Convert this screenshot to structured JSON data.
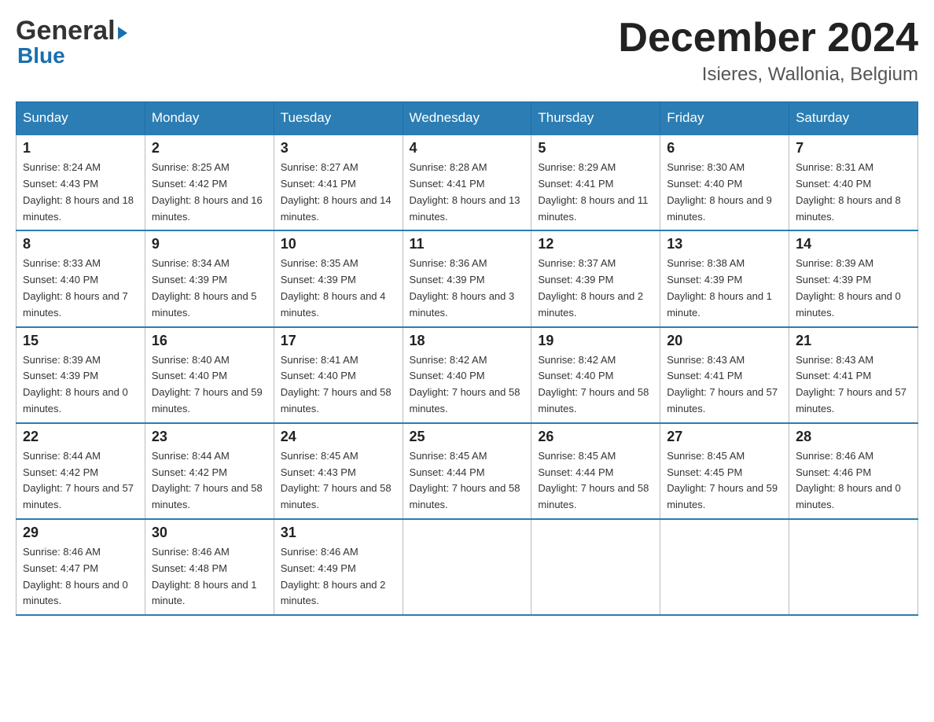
{
  "header": {
    "logo_general": "General",
    "logo_arrow": "▶",
    "logo_blue": "Blue",
    "month_title": "December 2024",
    "location": "Isieres, Wallonia, Belgium"
  },
  "weekdays": [
    "Sunday",
    "Monday",
    "Tuesday",
    "Wednesday",
    "Thursday",
    "Friday",
    "Saturday"
  ],
  "weeks": [
    [
      {
        "day": "1",
        "sunrise": "Sunrise: 8:24 AM",
        "sunset": "Sunset: 4:43 PM",
        "daylight": "Daylight: 8 hours and 18 minutes."
      },
      {
        "day": "2",
        "sunrise": "Sunrise: 8:25 AM",
        "sunset": "Sunset: 4:42 PM",
        "daylight": "Daylight: 8 hours and 16 minutes."
      },
      {
        "day": "3",
        "sunrise": "Sunrise: 8:27 AM",
        "sunset": "Sunset: 4:41 PM",
        "daylight": "Daylight: 8 hours and 14 minutes."
      },
      {
        "day": "4",
        "sunrise": "Sunrise: 8:28 AM",
        "sunset": "Sunset: 4:41 PM",
        "daylight": "Daylight: 8 hours and 13 minutes."
      },
      {
        "day": "5",
        "sunrise": "Sunrise: 8:29 AM",
        "sunset": "Sunset: 4:41 PM",
        "daylight": "Daylight: 8 hours and 11 minutes."
      },
      {
        "day": "6",
        "sunrise": "Sunrise: 8:30 AM",
        "sunset": "Sunset: 4:40 PM",
        "daylight": "Daylight: 8 hours and 9 minutes."
      },
      {
        "day": "7",
        "sunrise": "Sunrise: 8:31 AM",
        "sunset": "Sunset: 4:40 PM",
        "daylight": "Daylight: 8 hours and 8 minutes."
      }
    ],
    [
      {
        "day": "8",
        "sunrise": "Sunrise: 8:33 AM",
        "sunset": "Sunset: 4:40 PM",
        "daylight": "Daylight: 8 hours and 7 minutes."
      },
      {
        "day": "9",
        "sunrise": "Sunrise: 8:34 AM",
        "sunset": "Sunset: 4:39 PM",
        "daylight": "Daylight: 8 hours and 5 minutes."
      },
      {
        "day": "10",
        "sunrise": "Sunrise: 8:35 AM",
        "sunset": "Sunset: 4:39 PM",
        "daylight": "Daylight: 8 hours and 4 minutes."
      },
      {
        "day": "11",
        "sunrise": "Sunrise: 8:36 AM",
        "sunset": "Sunset: 4:39 PM",
        "daylight": "Daylight: 8 hours and 3 minutes."
      },
      {
        "day": "12",
        "sunrise": "Sunrise: 8:37 AM",
        "sunset": "Sunset: 4:39 PM",
        "daylight": "Daylight: 8 hours and 2 minutes."
      },
      {
        "day": "13",
        "sunrise": "Sunrise: 8:38 AM",
        "sunset": "Sunset: 4:39 PM",
        "daylight": "Daylight: 8 hours and 1 minute."
      },
      {
        "day": "14",
        "sunrise": "Sunrise: 8:39 AM",
        "sunset": "Sunset: 4:39 PM",
        "daylight": "Daylight: 8 hours and 0 minutes."
      }
    ],
    [
      {
        "day": "15",
        "sunrise": "Sunrise: 8:39 AM",
        "sunset": "Sunset: 4:39 PM",
        "daylight": "Daylight: 8 hours and 0 minutes."
      },
      {
        "day": "16",
        "sunrise": "Sunrise: 8:40 AM",
        "sunset": "Sunset: 4:40 PM",
        "daylight": "Daylight: 7 hours and 59 minutes."
      },
      {
        "day": "17",
        "sunrise": "Sunrise: 8:41 AM",
        "sunset": "Sunset: 4:40 PM",
        "daylight": "Daylight: 7 hours and 58 minutes."
      },
      {
        "day": "18",
        "sunrise": "Sunrise: 8:42 AM",
        "sunset": "Sunset: 4:40 PM",
        "daylight": "Daylight: 7 hours and 58 minutes."
      },
      {
        "day": "19",
        "sunrise": "Sunrise: 8:42 AM",
        "sunset": "Sunset: 4:40 PM",
        "daylight": "Daylight: 7 hours and 58 minutes."
      },
      {
        "day": "20",
        "sunrise": "Sunrise: 8:43 AM",
        "sunset": "Sunset: 4:41 PM",
        "daylight": "Daylight: 7 hours and 57 minutes."
      },
      {
        "day": "21",
        "sunrise": "Sunrise: 8:43 AM",
        "sunset": "Sunset: 4:41 PM",
        "daylight": "Daylight: 7 hours and 57 minutes."
      }
    ],
    [
      {
        "day": "22",
        "sunrise": "Sunrise: 8:44 AM",
        "sunset": "Sunset: 4:42 PM",
        "daylight": "Daylight: 7 hours and 57 minutes."
      },
      {
        "day": "23",
        "sunrise": "Sunrise: 8:44 AM",
        "sunset": "Sunset: 4:42 PM",
        "daylight": "Daylight: 7 hours and 58 minutes."
      },
      {
        "day": "24",
        "sunrise": "Sunrise: 8:45 AM",
        "sunset": "Sunset: 4:43 PM",
        "daylight": "Daylight: 7 hours and 58 minutes."
      },
      {
        "day": "25",
        "sunrise": "Sunrise: 8:45 AM",
        "sunset": "Sunset: 4:44 PM",
        "daylight": "Daylight: 7 hours and 58 minutes."
      },
      {
        "day": "26",
        "sunrise": "Sunrise: 8:45 AM",
        "sunset": "Sunset: 4:44 PM",
        "daylight": "Daylight: 7 hours and 58 minutes."
      },
      {
        "day": "27",
        "sunrise": "Sunrise: 8:45 AM",
        "sunset": "Sunset: 4:45 PM",
        "daylight": "Daylight: 7 hours and 59 minutes."
      },
      {
        "day": "28",
        "sunrise": "Sunrise: 8:46 AM",
        "sunset": "Sunset: 4:46 PM",
        "daylight": "Daylight: 8 hours and 0 minutes."
      }
    ],
    [
      {
        "day": "29",
        "sunrise": "Sunrise: 8:46 AM",
        "sunset": "Sunset: 4:47 PM",
        "daylight": "Daylight: 8 hours and 0 minutes."
      },
      {
        "day": "30",
        "sunrise": "Sunrise: 8:46 AM",
        "sunset": "Sunset: 4:48 PM",
        "daylight": "Daylight: 8 hours and 1 minute."
      },
      {
        "day": "31",
        "sunrise": "Sunrise: 8:46 AM",
        "sunset": "Sunset: 4:49 PM",
        "daylight": "Daylight: 8 hours and 2 minutes."
      },
      null,
      null,
      null,
      null
    ]
  ]
}
